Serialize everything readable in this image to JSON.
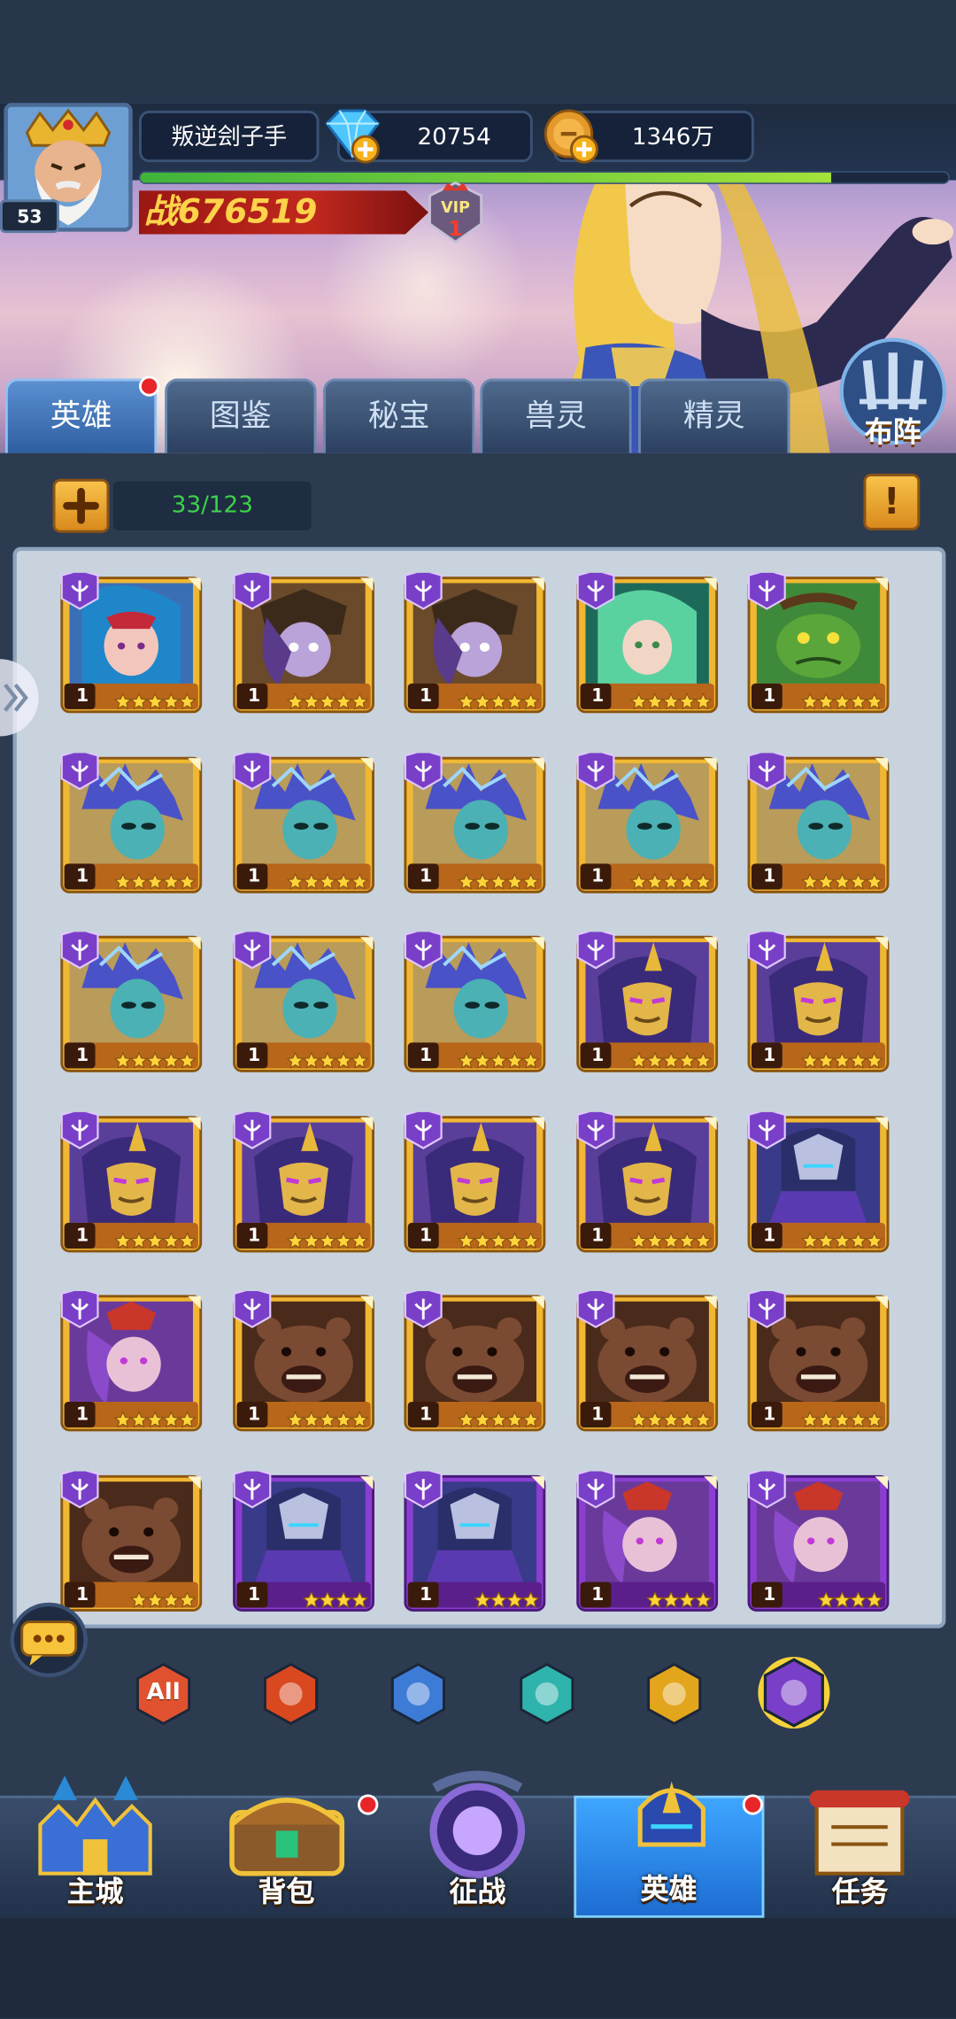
{
  "player": {
    "name": "叛逆刽子手",
    "level": "53",
    "diamonds": "20754",
    "gold": "1346万",
    "power_prefix": "战",
    "power": "676519",
    "vip_label": "VIP",
    "vip_level": "1",
    "exp_fraction": 0.855
  },
  "tabs": [
    {
      "label": "英雄",
      "active": true,
      "dot": true
    },
    {
      "label": "图鉴",
      "active": false,
      "dot": false
    },
    {
      "label": "秘宝",
      "active": false,
      "dot": false
    },
    {
      "label": "兽灵",
      "active": false,
      "dot": false
    },
    {
      "label": "精灵",
      "active": false,
      "dot": false
    }
  ],
  "formation_label": "布阵",
  "hero_count": "33/123",
  "info_label": "!",
  "heroes": [
    {
      "type": "siren",
      "level": "1",
      "stars": 5,
      "frame": "gold"
    },
    {
      "type": "witch",
      "level": "1",
      "stars": 5,
      "frame": "gold"
    },
    {
      "type": "witch",
      "level": "1",
      "stars": 5,
      "frame": "gold"
    },
    {
      "type": "dryad",
      "level": "1",
      "stars": 5,
      "frame": "gold"
    },
    {
      "type": "goblin",
      "level": "1",
      "stars": 5,
      "frame": "gold"
    },
    {
      "type": "frost",
      "level": "1",
      "stars": 5,
      "frame": "gold"
    },
    {
      "type": "frost",
      "level": "1",
      "stars": 5,
      "frame": "gold"
    },
    {
      "type": "frost",
      "level": "1",
      "stars": 5,
      "frame": "gold"
    },
    {
      "type": "frost",
      "level": "1",
      "stars": 5,
      "frame": "gold"
    },
    {
      "type": "frost",
      "level": "1",
      "stars": 5,
      "frame": "gold"
    },
    {
      "type": "frost",
      "level": "1",
      "stars": 5,
      "frame": "gold"
    },
    {
      "type": "frost",
      "level": "1",
      "stars": 5,
      "frame": "gold"
    },
    {
      "type": "frost",
      "level": "1",
      "stars": 5,
      "frame": "gold"
    },
    {
      "type": "mask",
      "level": "1",
      "stars": 5,
      "frame": "gold"
    },
    {
      "type": "mask",
      "level": "1",
      "stars": 5,
      "frame": "gold"
    },
    {
      "type": "mask",
      "level": "1",
      "stars": 5,
      "frame": "gold"
    },
    {
      "type": "mask",
      "level": "1",
      "stars": 5,
      "frame": "gold"
    },
    {
      "type": "mask",
      "level": "1",
      "stars": 5,
      "frame": "gold"
    },
    {
      "type": "mask",
      "level": "1",
      "stars": 5,
      "frame": "gold"
    },
    {
      "type": "knight",
      "level": "1",
      "stars": 5,
      "frame": "gold"
    },
    {
      "type": "sorceress",
      "level": "1",
      "stars": 5,
      "frame": "gold"
    },
    {
      "type": "bear",
      "level": "1",
      "stars": 5,
      "frame": "gold"
    },
    {
      "type": "bear",
      "level": "1",
      "stars": 5,
      "frame": "gold"
    },
    {
      "type": "bear",
      "level": "1",
      "stars": 5,
      "frame": "gold"
    },
    {
      "type": "bear",
      "level": "1",
      "stars": 5,
      "frame": "gold"
    },
    {
      "type": "bear",
      "level": "1",
      "stars": 4,
      "frame": "gold"
    },
    {
      "type": "knight",
      "level": "1",
      "stars": 4,
      "frame": "purple"
    },
    {
      "type": "knight",
      "level": "1",
      "stars": 4,
      "frame": "purple"
    },
    {
      "type": "sorceress",
      "level": "1",
      "stars": 4,
      "frame": "purple"
    },
    {
      "type": "sorceress",
      "level": "1",
      "stars": 4,
      "frame": "purple"
    }
  ],
  "filters": [
    {
      "icon": "all-faction-icon",
      "label": "All",
      "color": "#e0522f"
    },
    {
      "icon": "fire-faction-icon",
      "label": "",
      "color": "#d9481f"
    },
    {
      "icon": "cross-faction-icon",
      "label": "",
      "color": "#3c7bd6"
    },
    {
      "icon": "skull-faction-icon",
      "label": "",
      "color": "#2fb3ad"
    },
    {
      "icon": "wing-faction-icon",
      "label": "",
      "color": "#e2a51c"
    },
    {
      "icon": "trident-faction-icon",
      "label": "",
      "color": "#7a3fc9"
    }
  ],
  "nav": [
    {
      "label": "主城",
      "icon": "castle-icon",
      "active": false,
      "dot": false
    },
    {
      "label": "背包",
      "icon": "chest-icon",
      "active": false,
      "dot": true
    },
    {
      "label": "征战",
      "icon": "dragon-portal-icon",
      "active": false,
      "dot": false
    },
    {
      "label": "英雄",
      "icon": "helmet-icon",
      "active": true,
      "dot": true
    },
    {
      "label": "任务",
      "icon": "scroll-icon",
      "active": false,
      "dot": false
    }
  ],
  "colors": {
    "accent": "#3ea6ff",
    "gold": "#f0b733",
    "purple_frame": "#8a3fd0",
    "power_red": "#c0281d"
  }
}
